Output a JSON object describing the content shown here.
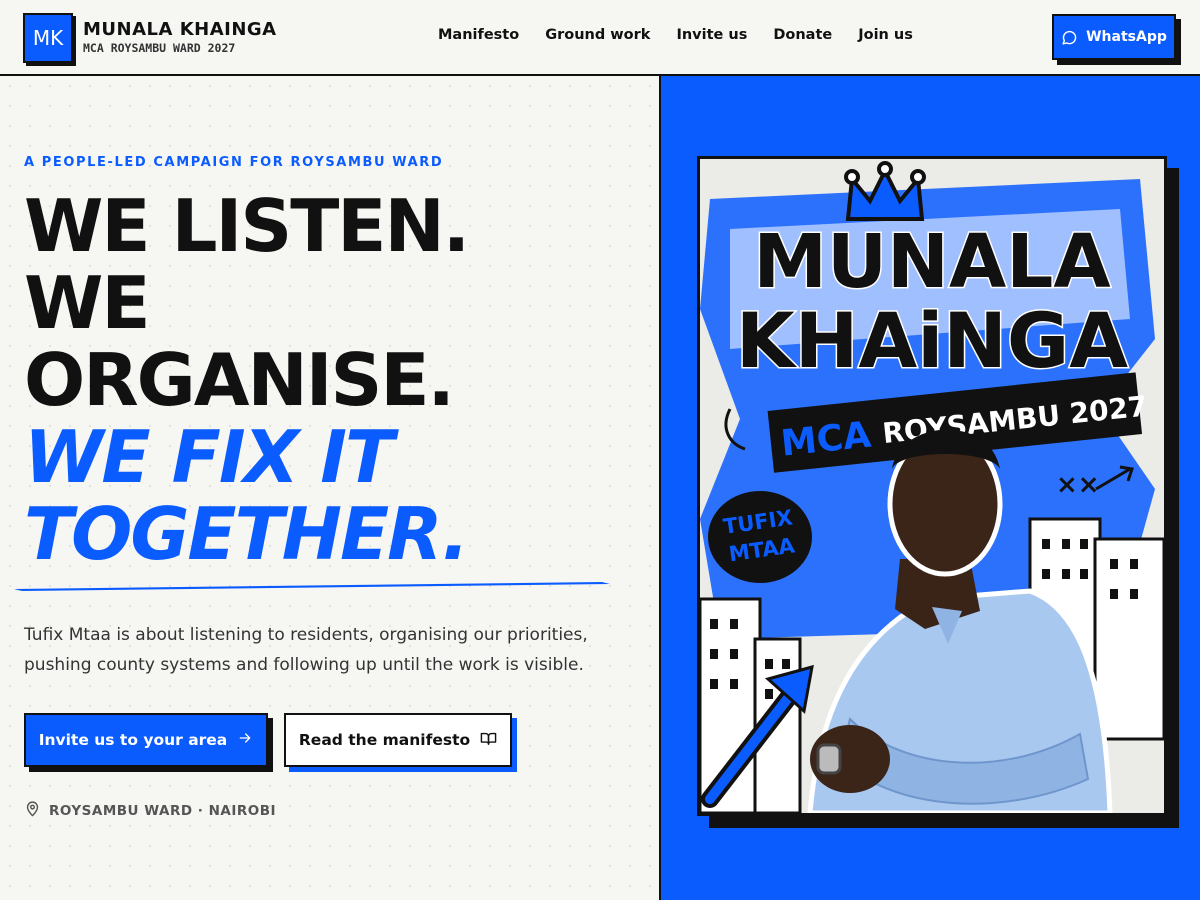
{
  "header": {
    "logo_initials": "MK",
    "brand_name": "MUNALA KHAINGA",
    "brand_sub": "MCA ROYSAMBU WARD 2027",
    "nav": [
      "Manifesto",
      "Ground work",
      "Invite us",
      "Donate",
      "Join us"
    ],
    "whatsapp_label": "WhatsApp"
  },
  "hero": {
    "eyebrow": "A PEOPLE-LED CAMPAIGN FOR ROYSAMBU WARD",
    "headline": [
      "WE LISTEN.",
      "WE",
      "ORGANISE."
    ],
    "headline_accent": [
      "WE FIX IT",
      "TOGETHER."
    ],
    "lede": "Tufix Mtaa is about listening to residents, organising our priorities, pushing county systems and following up until the work is visible.",
    "primary_cta": "Invite us to your area",
    "secondary_cta": "Read the manifesto",
    "location": "ROYSAMBU WARD · NAIROBI"
  },
  "poster": {
    "name_line1": "MUNALA",
    "name_line2": "KHAiNGA",
    "banner_accent": "MCA",
    "banner_rest": "ROYSAMBU 2027",
    "badge_line1": "TUFIX",
    "badge_line2": "MTAA",
    "scribble": "××"
  },
  "colors": {
    "accent": "#0b5cff",
    "ink": "#111111",
    "background": "#f6f6f3"
  },
  "icons": {
    "whatsapp": "chat-bubble-icon",
    "arrow": "arrow-right-icon",
    "book": "open-book-icon",
    "location": "map-pin-icon"
  }
}
